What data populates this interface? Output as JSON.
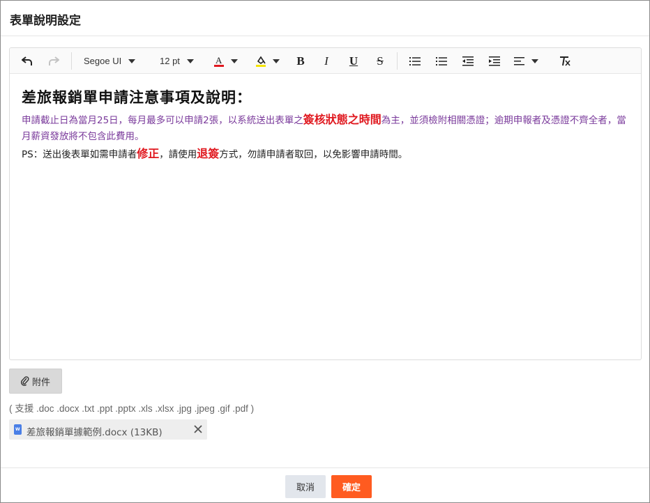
{
  "dialog": {
    "title": "表單說明設定"
  },
  "toolbar": {
    "font_family": "Segoe UI",
    "font_size": "12 pt",
    "text_color": "#e0181f",
    "highlight_color": "#f5e400",
    "bold_label": "B",
    "italic_label": "I",
    "underline_label": "U",
    "strike_label": "S",
    "icons": [
      "undo-icon",
      "redo-icon",
      "text-color-icon",
      "highlight-icon",
      "bullet-list-icon",
      "numbered-list-icon",
      "outdent-icon",
      "indent-icon",
      "align-icon",
      "clear-format-icon"
    ]
  },
  "content": {
    "heading": "差旅報銷單申請注意事項及說明：",
    "para1_a": "申請截止日為當月25日，每月最多可以申請2張，以系統送出表單之",
    "para1_hl": "簽核狀態之時間",
    "para1_b": "為主，並須檢附相關憑證；逾期申報者及憑證不齊全者，當月薪資發放將不包含此費用。",
    "para2_a": "PS：送出後表單如需申請者",
    "para2_hl1": "修正",
    "para2_b": "，請使用",
    "para2_hl2": "退簽",
    "para2_c": "方式，勿請申請者取回，以免影響申請時間。",
    "colors": {
      "para1": "#7a3a9b",
      "highlight": "#e0181f"
    }
  },
  "attachment": {
    "button_label": "附件",
    "support_note": "( 支援 .doc .docx .txt .ppt .pptx .xls .xlsx .jpg .jpeg .gif .pdf )",
    "files": [
      {
        "name": "差旅報銷單據範例.docx (13KB)"
      }
    ]
  },
  "footer": {
    "cancel_label": "取消",
    "ok_label": "確定",
    "ok_color": "#ff5b20"
  }
}
